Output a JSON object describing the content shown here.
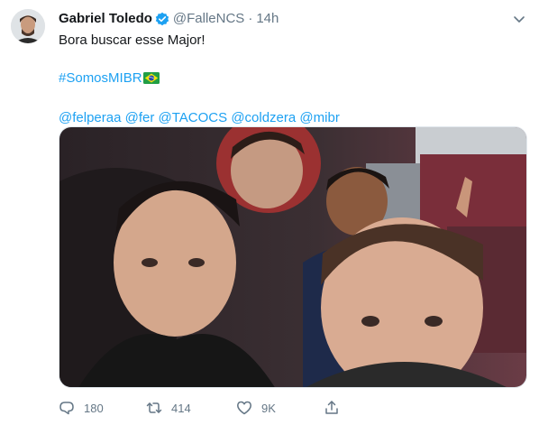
{
  "tweet": {
    "author_name": "Gabriel Toledo",
    "handle": "@FalleNCS",
    "separator": "·",
    "time": "14h",
    "text_line1": "Bora buscar esse Major!",
    "hashtag": "#SomosMIBR",
    "mentions": [
      "@felperaa",
      "@fer",
      "@TACOCS",
      "@coldzera",
      "@mibr"
    ],
    "counts": {
      "replies": "180",
      "retweets": "414",
      "likes": "9K"
    }
  },
  "icons": {
    "verified": "verified-badge-icon",
    "caret": "chevron-down-icon",
    "flag": "brazil-flag-icon",
    "reply": "reply-icon",
    "retweet": "retweet-icon",
    "like": "heart-icon",
    "share": "share-icon"
  },
  "colors": {
    "link": "#1da1f2",
    "meta": "#657786",
    "text": "#14171a",
    "verified": "#1da1f2"
  }
}
